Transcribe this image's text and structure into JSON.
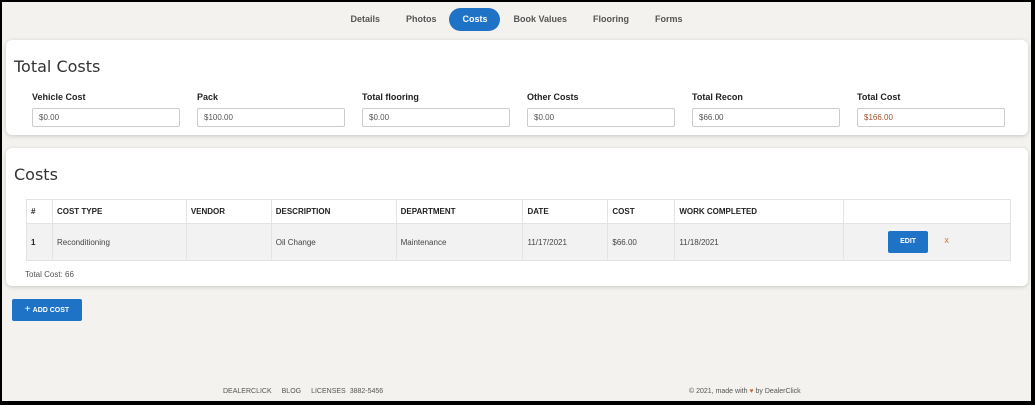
{
  "tabs": [
    {
      "label": "Details"
    },
    {
      "label": "Photos"
    },
    {
      "label": "Costs"
    },
    {
      "label": "Book Values"
    },
    {
      "label": "Flooring"
    },
    {
      "label": "Forms"
    }
  ],
  "totals": {
    "title": "Total Costs",
    "fields": [
      {
        "label": "Vehicle Cost",
        "value": "$0.00"
      },
      {
        "label": "Pack",
        "value": "$100.00"
      },
      {
        "label": "Total flooring",
        "value": "$0.00"
      },
      {
        "label": "Other Costs",
        "value": "$0.00"
      },
      {
        "label": "Total Recon",
        "value": "$66.00"
      },
      {
        "label": "Total Cost",
        "value": "$166.00"
      }
    ]
  },
  "costs": {
    "title": "Costs",
    "columns": [
      "#",
      "COST TYPE",
      "VENDOR",
      "DESCRIPTION",
      "DEPARTMENT",
      "DATE",
      "COST",
      "WORK COMPLETED",
      ""
    ],
    "rows": [
      {
        "num": "1",
        "cost_type": "Reconditioning",
        "vendor": "",
        "description": "Oil Change",
        "department": "Maintenance",
        "date": "11/17/2021",
        "cost": "$66.00",
        "work_completed": "11/18/2021",
        "edit_label": "EDIT",
        "delete_label": "x"
      }
    ],
    "total_line": "Total Cost: 66"
  },
  "add_cost": {
    "icon": "+",
    "label": "ADD COST"
  },
  "footer": {
    "links": [
      "DEALERCLICK",
      "BLOG",
      "LICENSES"
    ],
    "license_number": "3882-5456",
    "copyright_prefix": "© 2021, made with",
    "heart": "♥",
    "copyright_suffix": "by DealerClick"
  },
  "colors": {
    "accent": "#1f73c6",
    "delete": "#e06b2c",
    "background": "#f3f2ee"
  }
}
